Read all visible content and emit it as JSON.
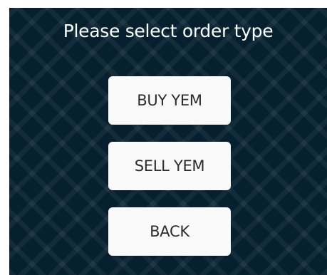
{
  "dialog": {
    "title": "Please select order type",
    "buttons": {
      "buy_label": "BUY YEM",
      "sell_label": "SELL YEM",
      "back_label": "BACK"
    }
  },
  "colors": {
    "background": "#06202f",
    "button_bg": "#f9f9f9",
    "button_text": "#2c2c2c",
    "title_text": "#ffffff"
  }
}
